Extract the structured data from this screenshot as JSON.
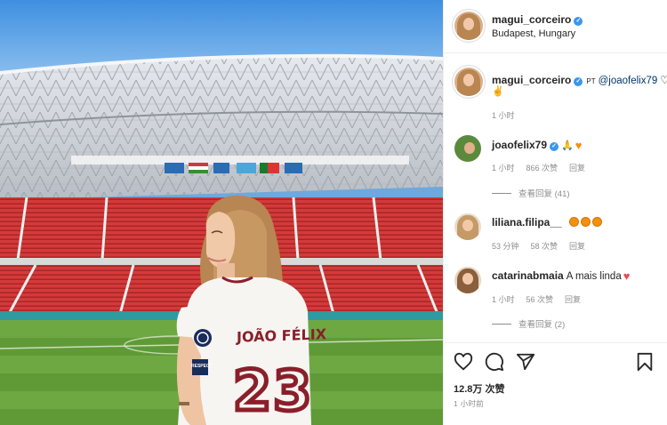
{
  "post": {
    "username": "magui_corceiro",
    "location": "Budapest, Hungary"
  },
  "caption": {
    "username": "magui_corceiro",
    "lang_tag": "PT",
    "mention": "@joaofelix79",
    "time": "1 小时"
  },
  "comments": [
    {
      "username": "joaofelix79",
      "verified": true,
      "text": "",
      "emojis": [
        "pray-icon",
        "orange-heart-icon"
      ],
      "time": "1 小时",
      "likes": "866 次赞",
      "reply": "回复",
      "view_replies": "查看回复 (41)"
    },
    {
      "username": "liliana.filipa__",
      "verified": false,
      "text": "",
      "emojis": [
        "star-struck-icon",
        "star-struck-icon",
        "star-struck-icon"
      ],
      "time": "53 分钟",
      "likes": "58 次赞",
      "reply": "回复",
      "view_replies": ""
    },
    {
      "username": "catarinabmaia",
      "verified": false,
      "text": "A mais linda",
      "emojis": [
        "red-heart-icon"
      ],
      "time": "1 小时",
      "likes": "56 次赞",
      "reply": "回复",
      "view_replies": "查看回复 (2)"
    }
  ],
  "footer": {
    "likes": "12.8万 次赞",
    "time_ago": "1 小时前"
  },
  "photo": {
    "jersey_name": "JOÃO FÉLIX",
    "jersey_number": "23",
    "sleeve_patch": "RESPECT"
  },
  "colors": {
    "verified": "#3897f0",
    "heart": "#ed4956",
    "meta": "#8e8e8e",
    "mention": "#00376b"
  }
}
